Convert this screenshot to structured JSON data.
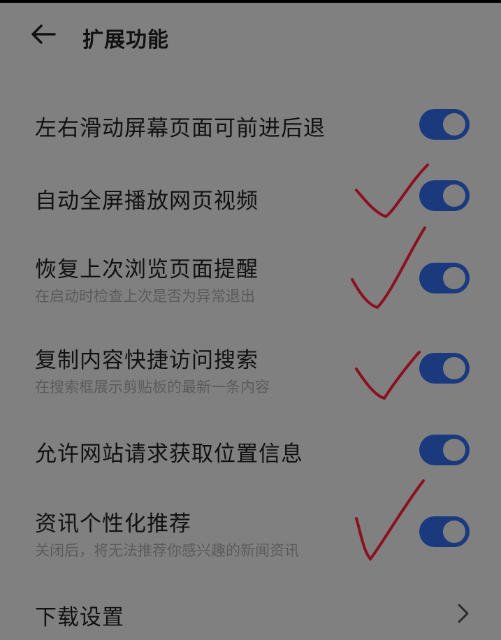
{
  "header": {
    "title": "扩展功能"
  },
  "settings": [
    {
      "label": "左右滑动屏幕页面可前进后退",
      "sublabel": "",
      "enabled": true
    },
    {
      "label": "自动全屏播放网页视频",
      "sublabel": "",
      "enabled": true
    },
    {
      "label": "恢复上次浏览页面提醒",
      "sublabel": "在启动时检查上次是否为异常退出",
      "enabled": true
    },
    {
      "label": "复制内容快捷访问搜索",
      "sublabel": "在搜索框展示剪贴板的最新一条内容",
      "enabled": true
    },
    {
      "label": "允许网站请求获取位置信息",
      "sublabel": "",
      "enabled": true
    },
    {
      "label": "资讯个性化推荐",
      "sublabel": "关闭后，将无法推荐你感兴趣的新闻资讯",
      "enabled": true
    }
  ],
  "download_settings": {
    "label": "下载设置"
  },
  "colors": {
    "overlay_bg": "#808080",
    "toggle_on": "#1b3a7e",
    "check_mark": "#8b1020"
  }
}
